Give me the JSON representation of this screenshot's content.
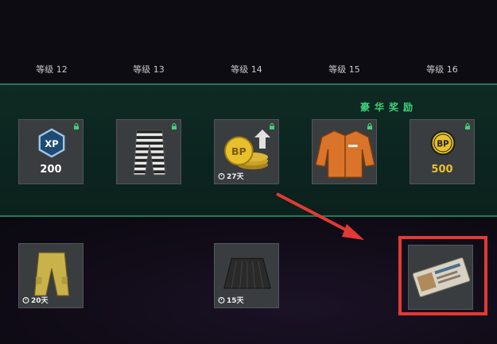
{
  "levels": [
    {
      "label": "等级 12"
    },
    {
      "label": "等级 13"
    },
    {
      "label": "等级 14"
    },
    {
      "label": "等级 15"
    },
    {
      "label": "等级 16"
    }
  ],
  "premium_title": "豪华奖励",
  "premium_rewards": [
    {
      "name": "xp-badge",
      "text": "200"
    },
    {
      "name": "striped-pants"
    },
    {
      "name": "bp-coins-upgrade",
      "timer": "27天"
    },
    {
      "name": "orange-jacket"
    },
    {
      "name": "bp-coin",
      "text": "500"
    }
  ],
  "free_rewards": [
    {
      "name": "yellow-pants",
      "timer": "20天"
    },
    {
      "name": "black-skirt",
      "timer": "15天"
    },
    {
      "name": "ticket-card"
    }
  ],
  "colors": {
    "accent_green": "#3fd27a",
    "band_border": "#1f7a5a",
    "highlight_red": "#e23a34",
    "bp_gold": "#e8c02c"
  }
}
